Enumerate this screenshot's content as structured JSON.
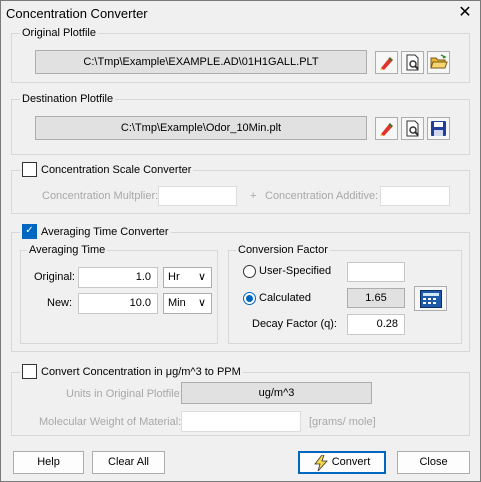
{
  "window": {
    "title": "Concentration Converter",
    "close_glyph": "✕"
  },
  "original": {
    "label": "Original Plotfile",
    "path": "C:\\Tmp\\Example\\EXAMPLE.AD\\01H1GALL.PLT",
    "icons": [
      "pencil-icon",
      "view-file-icon",
      "open-folder-icon"
    ]
  },
  "destination": {
    "label": "Destination Plotfile",
    "path": "C:\\Tmp\\Example\\Odor_10Min.plt",
    "icons": [
      "pencil-icon",
      "view-file-icon",
      "save-disk-icon"
    ]
  },
  "scale": {
    "label": "Concentration Scale Converter",
    "checked": false,
    "multiplier_label": "Concentration Multplier:",
    "plus": "+",
    "additive_label": "Concentration Additive:",
    "multiplier_value": "",
    "additive_value": ""
  },
  "averaging": {
    "label": "Averaging Time Converter",
    "checked": true,
    "time_group": "Averaging Time",
    "original_label": "Original:",
    "original_value": "1.0",
    "original_unit": "Hr",
    "new_label": "New:",
    "new_value": "10.0",
    "new_unit": "Min",
    "conv_group": "Conversion Factor",
    "user_specified_label": "User-Specified",
    "user_specified_value": "",
    "calculated_label": "Calculated",
    "calculated_value": "1.65",
    "decay_label": "Decay Factor (q):",
    "decay_value": "0.28"
  },
  "ppm": {
    "label": "Convert Concentration in μg/m^3 to PPM",
    "checked": false,
    "units_label": "Units in Original Plotfile:",
    "units_value": "ug/m^3",
    "mw_label": "Molecular Weight of Material:",
    "mw_value": "",
    "mw_unit": "[grams/ mole]"
  },
  "buttons": {
    "help": "Help",
    "clear_all": "Clear All",
    "convert": "Convert",
    "close": "Close"
  },
  "colors": {
    "accent": "#0067c0",
    "calc_icon": "#1e5aa8"
  }
}
